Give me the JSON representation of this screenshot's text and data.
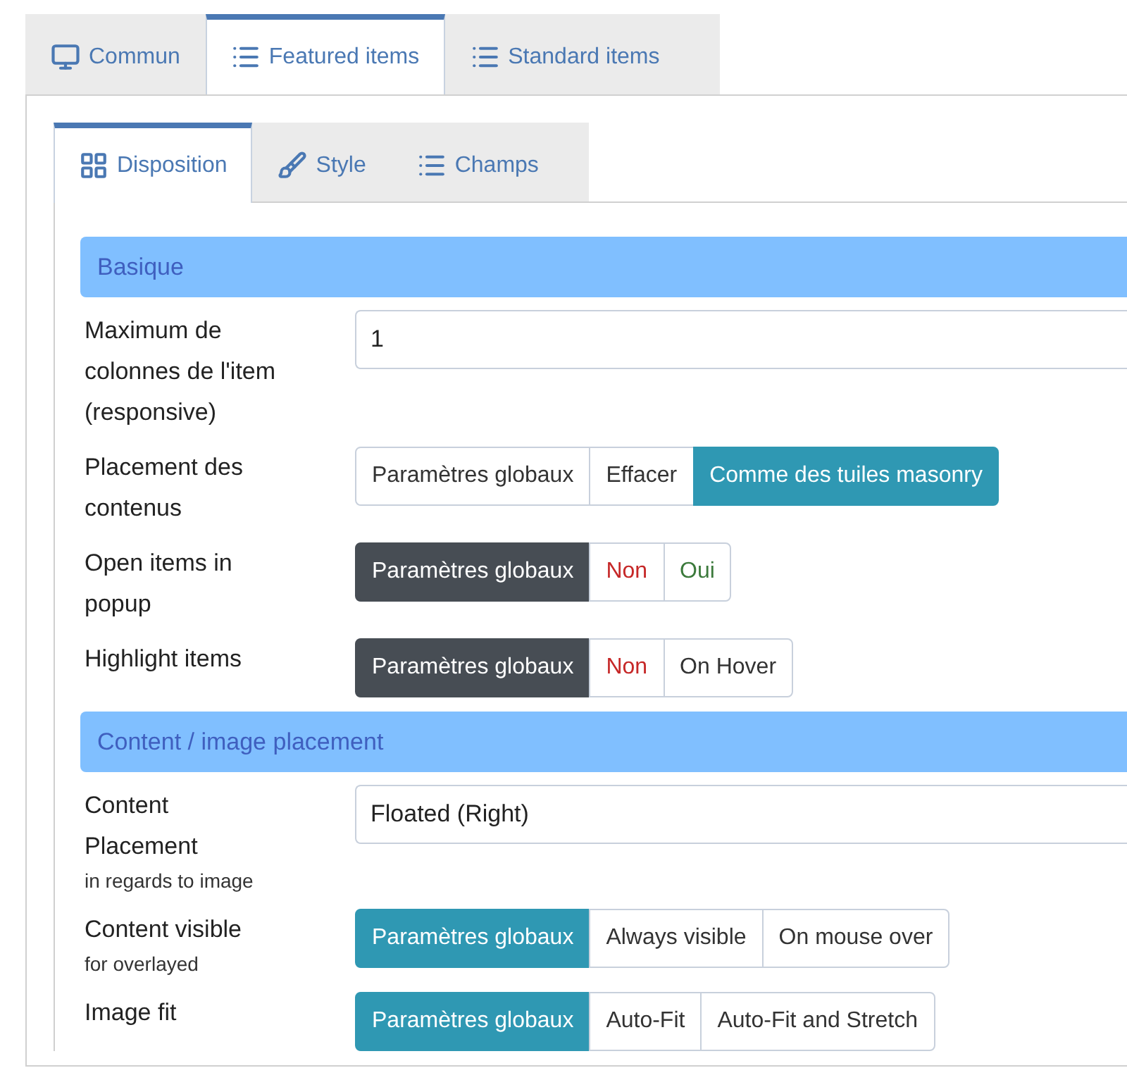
{
  "tabs": [
    {
      "label": "Commun",
      "selected": false
    },
    {
      "label": "Featured items",
      "selected": true
    },
    {
      "label": "Standard items",
      "selected": false
    }
  ],
  "subtabs": [
    {
      "label": "Disposition",
      "selected": true
    },
    {
      "label": "Style",
      "selected": false
    },
    {
      "label": "Champs",
      "selected": false
    }
  ],
  "sections": [
    {
      "title": "Basique",
      "rows": [
        {
          "kind": "input",
          "label": "Maximum de colonnes de l'item (responsive)",
          "value": "1"
        },
        {
          "kind": "buttons",
          "label": "Placement des contenus",
          "options": [
            {
              "label": "Paramètres globaux",
              "selected": false,
              "color": "#333333"
            },
            {
              "label": "Effacer",
              "selected": false,
              "color": "#333333"
            },
            {
              "label": "Comme des tuiles masonry",
              "selected": true,
              "color": "#2f98b3"
            }
          ]
        },
        {
          "kind": "buttons",
          "label": "Open items in popup",
          "options": [
            {
              "label": "Paramètres globaux",
              "selected": true,
              "color": "#474d54"
            },
            {
              "label": "Non",
              "selected": false,
              "color": "#c62828"
            },
            {
              "label": "Oui",
              "selected": false,
              "color": "#3c7a3c"
            }
          ]
        },
        {
          "kind": "buttons",
          "label": "Highlight items",
          "options": [
            {
              "label": "Paramètres globaux",
              "selected": true,
              "color": "#474d54"
            },
            {
              "label": "Non",
              "selected": false,
              "color": "#c62828"
            },
            {
              "label": "On Hover",
              "selected": false,
              "color": "#333333"
            }
          ]
        }
      ]
    },
    {
      "title": "Content / image placement",
      "rows": [
        {
          "kind": "input",
          "label": "Content Placement",
          "hint": "in regards to image",
          "value": "Floated (Right)"
        },
        {
          "kind": "buttons",
          "label": "Content visible",
          "hint": "for overlayed",
          "options": [
            {
              "label": "Paramètres globaux",
              "selected": true,
              "color": "#2f98b3"
            },
            {
              "label": "Always visible",
              "selected": false,
              "color": "#333333"
            },
            {
              "label": "On mouse over",
              "selected": false,
              "color": "#333333"
            }
          ]
        },
        {
          "kind": "buttons",
          "label": "Image fit",
          "options": [
            {
              "label": "Paramètres globaux",
              "selected": true,
              "color": "#2f98b3"
            },
            {
              "label": "Auto-Fit",
              "selected": false,
              "color": "#333333"
            },
            {
              "label": "Auto-Fit and Stretch",
              "selected": false,
              "color": "#333333"
            }
          ]
        }
      ]
    }
  ]
}
